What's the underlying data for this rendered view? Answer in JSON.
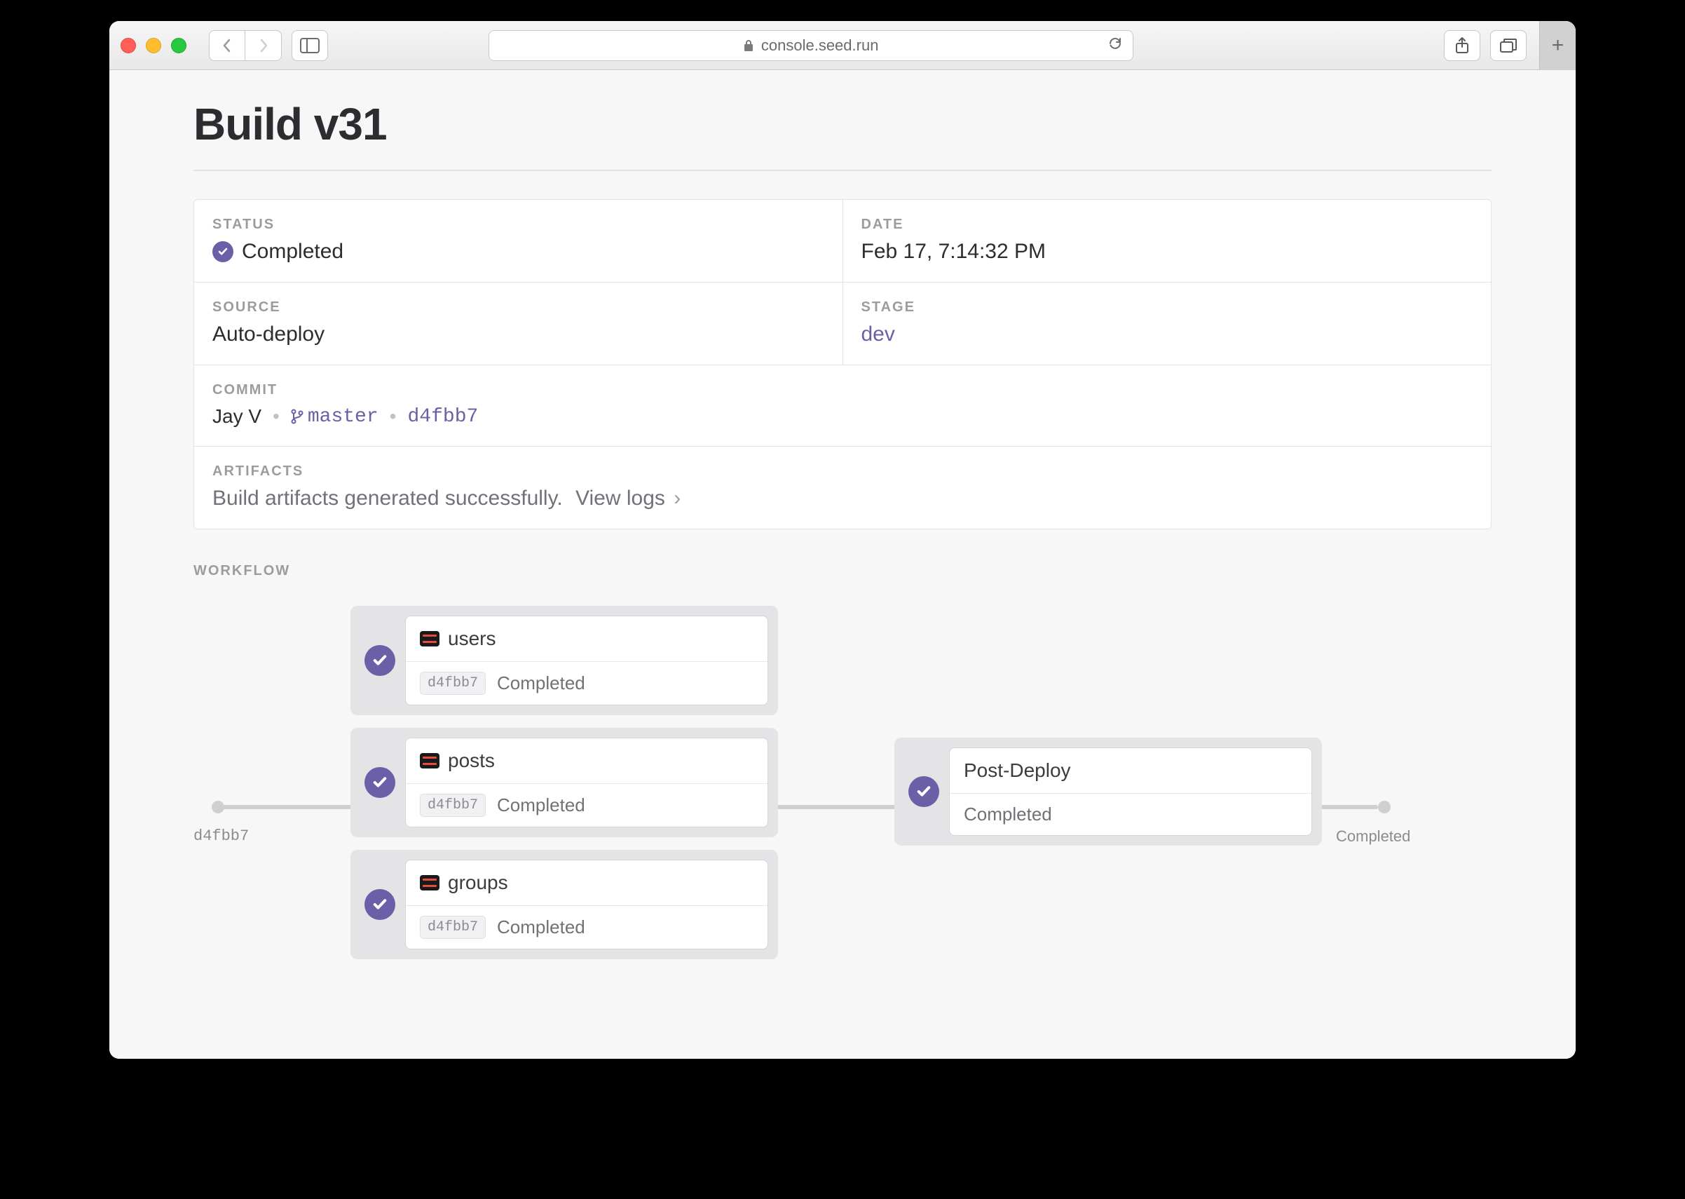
{
  "browser": {
    "url": "console.seed.run"
  },
  "page_title": "Build v31",
  "info": {
    "status_label": "STATUS",
    "status_value": "Completed",
    "date_label": "DATE",
    "date_value": "Feb 17, 7:14:32 PM",
    "source_label": "SOURCE",
    "source_value": "Auto-deploy",
    "stage_label": "STAGE",
    "stage_value": "dev",
    "commit_label": "COMMIT",
    "commit_author": "Jay V",
    "commit_branch": "master",
    "commit_sha": "d4fbb7",
    "artifacts_label": "ARTIFACTS",
    "artifacts_text": "Build artifacts generated successfully.",
    "artifacts_link": "View logs"
  },
  "workflow": {
    "label": "WORKFLOW",
    "start_sha": "d4fbb7",
    "end_label": "Completed",
    "services": [
      {
        "name": "users",
        "sha": "d4fbb7",
        "status": "Completed"
      },
      {
        "name": "posts",
        "sha": "d4fbb7",
        "status": "Completed"
      },
      {
        "name": "groups",
        "sha": "d4fbb7",
        "status": "Completed"
      }
    ],
    "post_deploy": {
      "name": "Post-Deploy",
      "status": "Completed"
    }
  }
}
